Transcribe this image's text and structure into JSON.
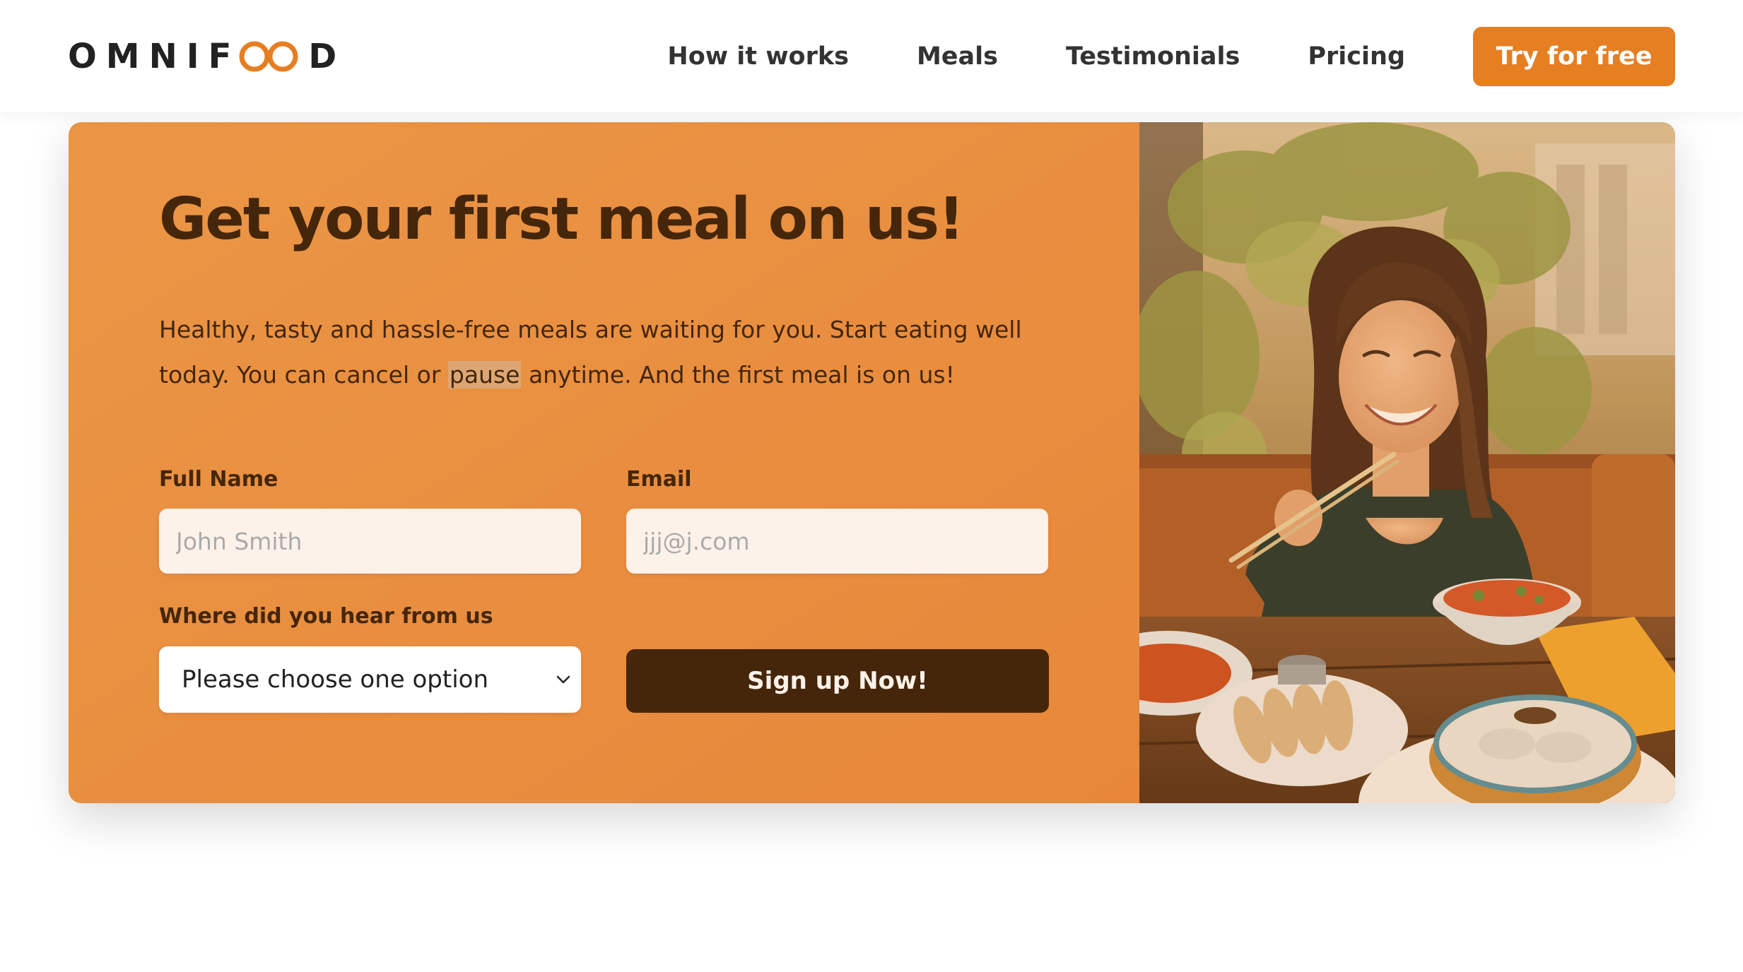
{
  "brand": {
    "logo_prefix": "OMNIF",
    "logo_suffix": "D",
    "logo_mark_icon": "infinity-icon",
    "accent_color": "#e67e22",
    "dark_color": "#45260a",
    "light_color": "#fdf2e9"
  },
  "nav": {
    "links": [
      "How it works",
      "Meals",
      "Testimonials",
      "Pricing"
    ],
    "cta_label": "Try for free"
  },
  "cta": {
    "title": "Get your first meal on us!",
    "description_before": "Healthy, tasty and hassle-free meals are waiting for you. Start eating well today. You can cancel or ",
    "description_highlight": "pause",
    "description_after": " anytime. And the first meal is on us!",
    "form": {
      "full_name_label": "Full Name",
      "full_name_placeholder": "John Smith",
      "email_label": "Email",
      "email_placeholder": "jjj@j.com",
      "source_label": "Where did you hear from us",
      "source_selected": "Please choose one option",
      "submit_label": "Sign up Now!"
    },
    "photo_icon": "woman-eating-photo"
  }
}
